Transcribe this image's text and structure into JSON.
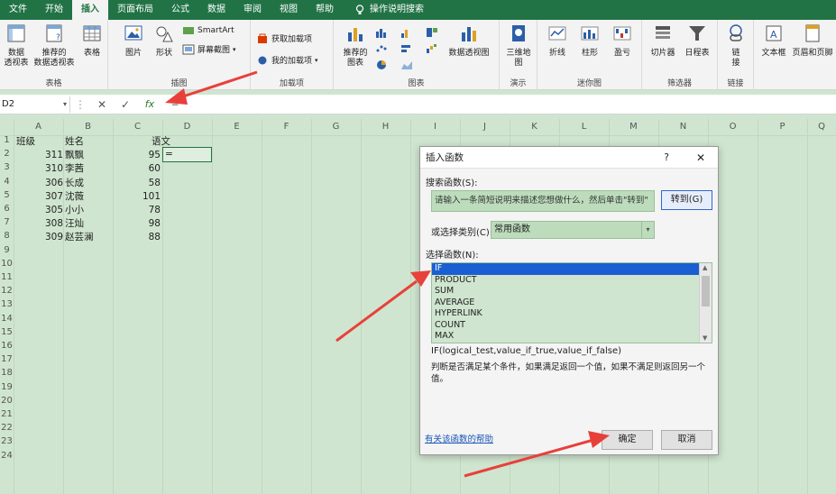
{
  "tabs": [
    {
      "label": "文件"
    },
    {
      "label": "开始"
    },
    {
      "label": "插入",
      "active": true
    },
    {
      "label": "页面布局"
    },
    {
      "label": "公式"
    },
    {
      "label": "数据"
    },
    {
      "label": "审阅"
    },
    {
      "label": "视图"
    },
    {
      "label": "帮助"
    }
  ],
  "tell_me": "操作说明搜索",
  "ribbon": {
    "tables": {
      "label": "表格",
      "pivot": "数据\n透视表",
      "recommended_pivot": "推荐的\n数据透视表",
      "table": "表格"
    },
    "illustrations": {
      "label": "插图",
      "picture": "图片",
      "shapes": "形状",
      "smartart": "SmartArt",
      "screenshot": "屏幕截图"
    },
    "addins": {
      "label": "加载项",
      "get": "获取加载项",
      "mine": "我的加载项"
    },
    "charts": {
      "label": "图表",
      "recommended": "推荐的\n图表",
      "pivot_chart": "数据透视图"
    },
    "tours": {
      "label": "演示",
      "map3d": "三维地\n图"
    },
    "sparklines": {
      "label": "迷你图",
      "line": "折线",
      "column": "柱形",
      "winloss": "盈亏"
    },
    "filters": {
      "label": "筛选器",
      "slicer": "切片器",
      "timeline": "日程表"
    },
    "links": {
      "label": "链接",
      "link": "链\n接"
    },
    "text": {
      "textbox": "文本框",
      "header_footer": "页眉和页脚"
    }
  },
  "formula_bar": {
    "name_box": "D2",
    "content": "="
  },
  "columns": [
    "A",
    "B",
    "C",
    "D",
    "E",
    "F",
    "G",
    "H",
    "I",
    "J",
    "K",
    "L",
    "M",
    "N",
    "O",
    "P",
    "Q"
  ],
  "rows": [
    "1",
    "2",
    "3",
    "4",
    "5",
    "6",
    "7",
    "8",
    "9",
    "10",
    "11",
    "12",
    "13",
    "14",
    "15",
    "16",
    "17",
    "18",
    "19",
    "20",
    "21",
    "22",
    "23",
    "24"
  ],
  "headers": {
    "class": "班级",
    "name": "姓名",
    "chinese": "语文"
  },
  "records": [
    {
      "class": "311",
      "name": "飘飘",
      "score": "95"
    },
    {
      "class": "310",
      "name": "李茜",
      "score": "60"
    },
    {
      "class": "306",
      "name": "长成",
      "score": "58"
    },
    {
      "class": "307",
      "name": "沈薇",
      "score": "101"
    },
    {
      "class": "305",
      "name": "小小",
      "score": "78"
    },
    {
      "class": "308",
      "name": "汪灿",
      "score": "98"
    },
    {
      "class": "309",
      "name": "赵芸澜",
      "score": "88"
    }
  ],
  "active_cell_value": "=",
  "dialog": {
    "title": "插入函数",
    "help": "?",
    "close": "✕",
    "search_label": "搜索函数(S):",
    "search_placeholder": "请输入一条简短说明来描述您想做什么，然后单击\"转到\"",
    "go_button": "转到(G)",
    "category_label": "或选择类别(C):",
    "category_value": "常用函数",
    "list_label": "选择函数(N):",
    "functions": [
      "IF",
      "PRODUCT",
      "SUM",
      "AVERAGE",
      "HYPERLINK",
      "COUNT",
      "MAX"
    ],
    "signature": "IF(logical_test,value_if_true,value_if_false)",
    "description": "判断是否满足某个条件，如果满足返回一个值，如果不满足则返回另一个值。",
    "help_link": "有关该函数的帮助",
    "ok": "确定",
    "cancel": "取消"
  },
  "colors": {
    "excel_green": "#217346",
    "annotation_red": "#e8403a",
    "selection_blue": "#1a5fd1"
  }
}
